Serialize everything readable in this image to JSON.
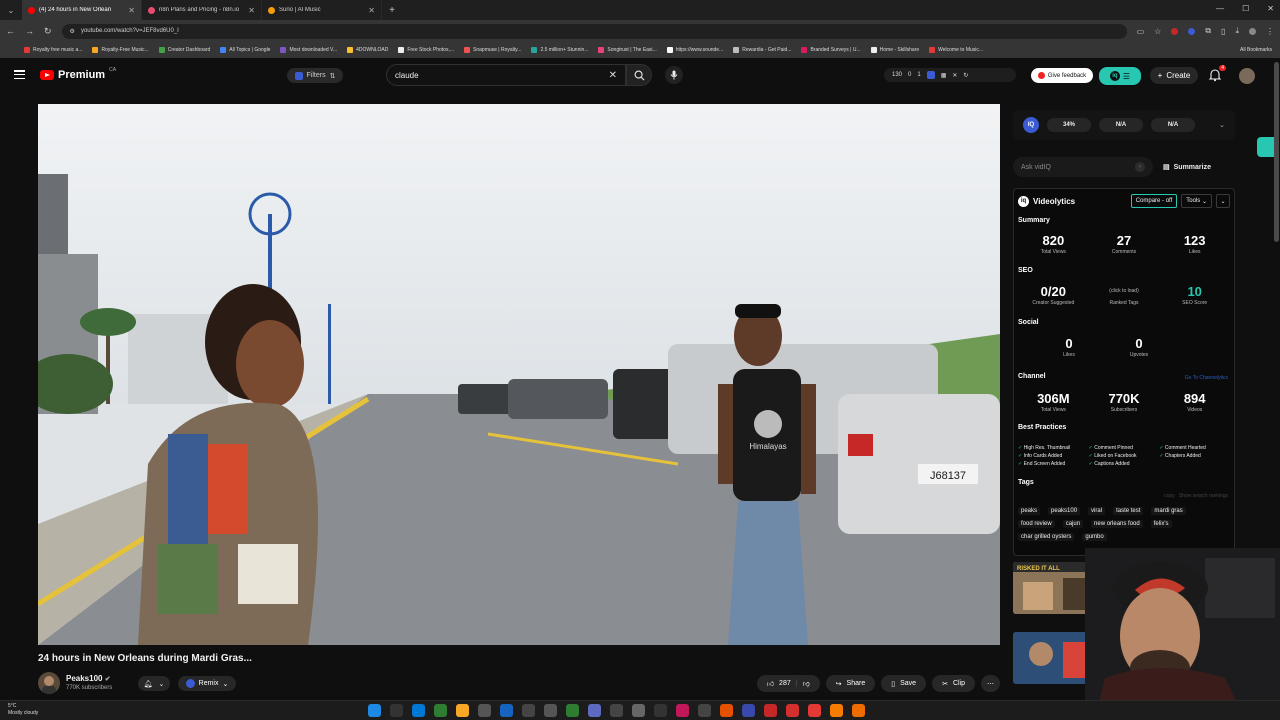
{
  "browser": {
    "tabs": [
      {
        "label": "(4) 24 hours in New Orlean",
        "active": true,
        "color": "#ff0000"
      },
      {
        "label": "n8n Plans and Pricing - n8n.io",
        "active": false,
        "color": "#ea4b71"
      },
      {
        "label": "Suno | AI Music",
        "active": false,
        "color": "#f59e0b"
      }
    ],
    "url": "youtube.com/watch?v=JEF8vd6U0_I",
    "bookmarks": [
      "Royalty free music a...",
      "Royalty-Free Music...",
      "Creator Dashboard",
      "All Topics | Google",
      "Most downloaded V...",
      "4DOWNLOAD",
      "Free Stock Photos,...",
      "Snapmuse | Royalty...",
      "2.5 million+ Stunnin...",
      "Songtrust | The Easi...",
      "https://www.sounde...",
      "Rewardia - Get Paid...",
      "Branded Surveys | U...",
      "Home - Skillshare",
      "Welcome to Music..."
    ],
    "all_bookmarks": "All Bookmarks"
  },
  "youtube": {
    "logo_text": "Premium",
    "country": "CA",
    "filters_label": "Filters",
    "search_value": "claude",
    "header_stats": [
      "130",
      "0",
      "1"
    ],
    "feedback_label": "Give feedback",
    "create_label": "Create",
    "notif_count": "4"
  },
  "video": {
    "title": "24 hours in New Orleans during Mardi Gras...",
    "channel_name": "Peaks100",
    "channel_subs": "770K subscribers",
    "remix_label": "Remix",
    "likes": "287",
    "share_label": "Share",
    "save_label": "Save",
    "clip_label": "Clip",
    "plate_text": "J68137",
    "shirt_text": "Himalayas"
  },
  "vidiq": {
    "score_pills": [
      "34%",
      "N/A",
      "N/A"
    ],
    "ask_placeholder": "Ask vidIQ",
    "summarize_label": "Summarize",
    "videolytics_title": "Videolytics",
    "compare_label": "Compare - off",
    "tools_label": "Tools",
    "summary_label": "Summary",
    "summary": [
      {
        "value": "820",
        "label": "Total Views"
      },
      {
        "value": "27",
        "label": "Comments"
      },
      {
        "value": "123",
        "label": "Likes"
      }
    ],
    "seo_label": "SEO",
    "seo": [
      {
        "value": "0/20",
        "label": "Creator Suggested"
      },
      {
        "value": "(click to load)",
        "label": "Ranked Tags"
      },
      {
        "value": "10",
        "label": "SEO Score"
      }
    ],
    "social_label": "Social",
    "social": [
      {
        "value": "0",
        "label": "Likes"
      },
      {
        "value": "0",
        "label": "Upvotes"
      }
    ],
    "channel_label": "Channel",
    "channel_link": "Go To Channelytics",
    "channel": [
      {
        "value": "306M",
        "label": "Total Views"
      },
      {
        "value": "770K",
        "label": "Subscribers"
      },
      {
        "value": "894",
        "label": "Videos"
      }
    ],
    "best_practices_label": "Best Practices",
    "best_practices": [
      "High Res. Thumbnail",
      "Comment Pinned",
      "Comment Hearted",
      "Info Cards Added",
      "Liked on Facebook",
      "Chapters Added",
      "End Screen Added",
      "Captions Added"
    ],
    "tags_label": "Tags",
    "tag_copy": "copy",
    "tag_rankings": "Show search rankings",
    "tags": [
      "peaks",
      "peaks100",
      "viral",
      "taste test",
      "mardi gras",
      "food review",
      "cajun",
      "new orleans food",
      "felix's",
      "char grilled oysters",
      "gumbo"
    ]
  },
  "recommended": {
    "thumb1_text": "RISKED IT ALL"
  },
  "taskbar": {
    "temp": "5°C",
    "weather": "Mostly cloudy"
  }
}
